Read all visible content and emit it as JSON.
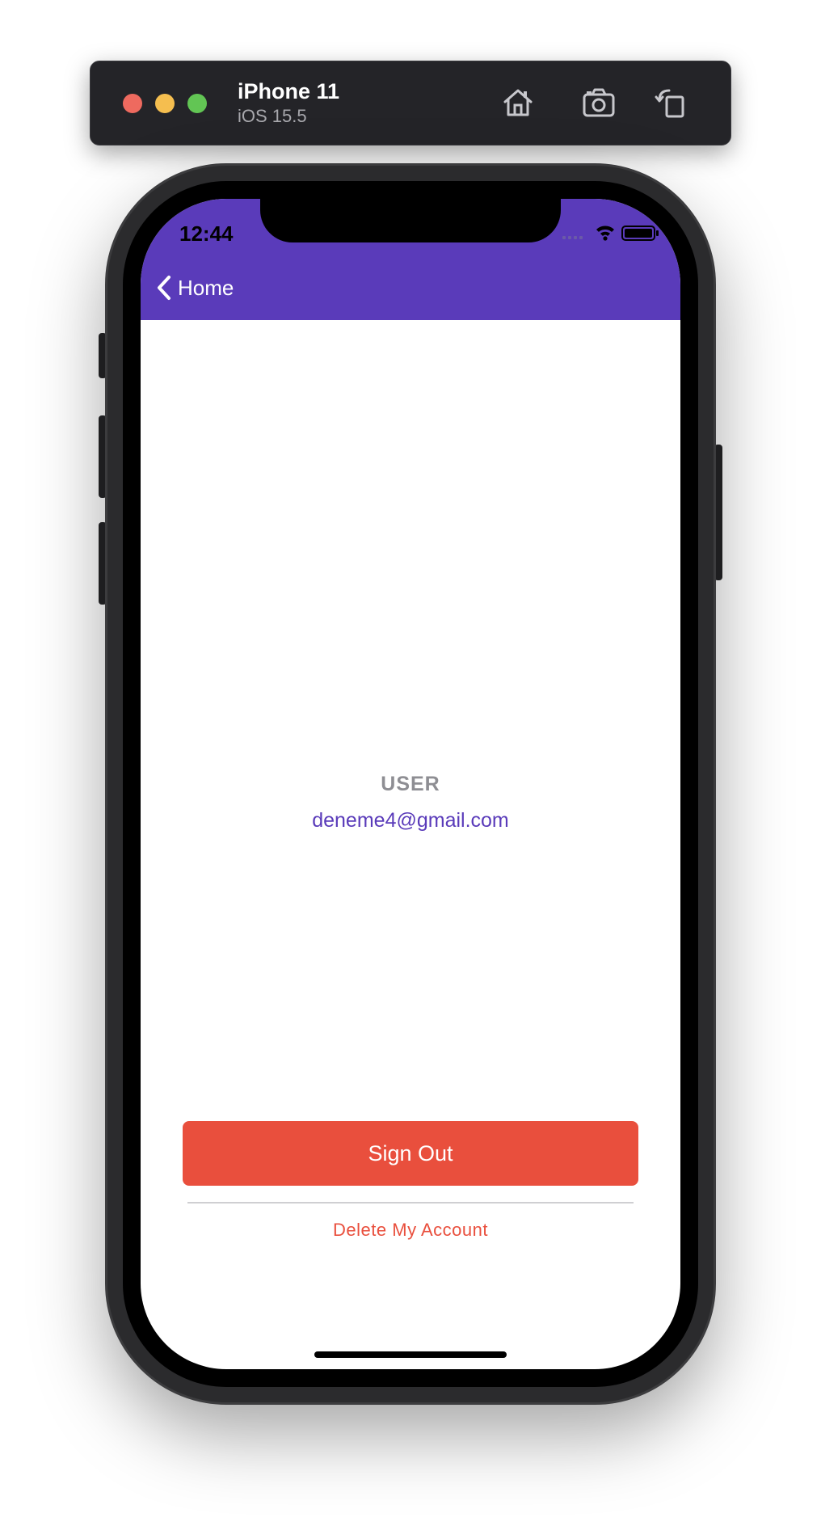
{
  "simulator": {
    "device_name": "iPhone 11",
    "os_version": "iOS 15.5",
    "toolbar_icons": [
      "home-icon",
      "screenshot-icon",
      "rotate-icon"
    ]
  },
  "status_bar": {
    "time": "12:44",
    "icons": [
      "cellular-icon",
      "wifi-icon",
      "battery-icon"
    ]
  },
  "nav_bar": {
    "back_label": "Home",
    "back_icon": "chevron-left-icon"
  },
  "profile": {
    "heading": "USER",
    "email": "deneme4@gmail.com"
  },
  "actions": {
    "sign_out_label": "Sign Out",
    "delete_account_label": "Delete My Account"
  },
  "colors": {
    "accent": "#5a3bba",
    "danger": "#e94f3d",
    "muted": "#8e8e93"
  }
}
